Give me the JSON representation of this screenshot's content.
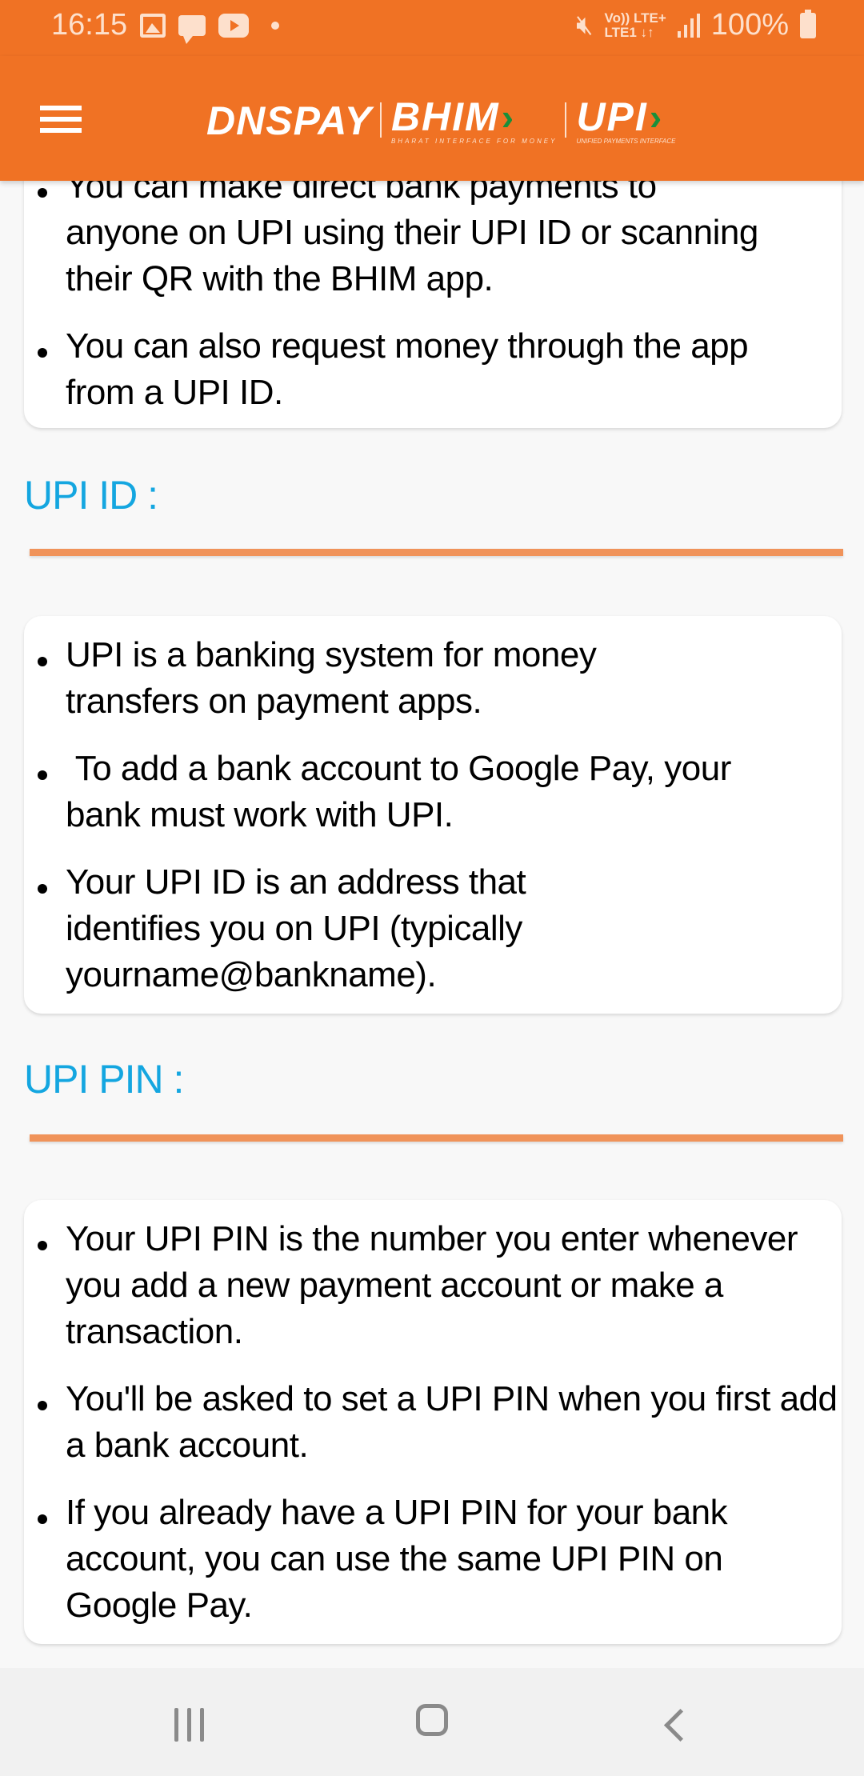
{
  "status_bar": {
    "time": "16:15",
    "left_icons": [
      "gallery-icon",
      "message-icon",
      "youtube-icon",
      "notification-dot-icon"
    ],
    "right_icons": [
      "mute-icon",
      "volte-lte-icon",
      "signal-icon",
      "battery-icon"
    ],
    "volte_top": "Vo)) LTE+",
    "volte_bottom": "LTE1 ↓↑",
    "battery": "100%"
  },
  "app_bar": {
    "menu_icon": "hamburger-menu-icon",
    "logo_dnspay": "DNSPAY",
    "logo_bhim": "BHIM",
    "logo_bhim_tagline": "BHARAT INTERFACE FOR MONEY",
    "logo_upi": "UPI",
    "logo_upi_tagline": "UNIFIED PAYMENTS INTERFACE",
    "logo_chevron": "›"
  },
  "colors": {
    "brand_orange": "#f07224",
    "section_title_blue": "#14a6e0",
    "divider_orange": "#f0935a",
    "chevron_green": "#1a8f3a"
  },
  "sections": [
    {
      "title": "",
      "bullets": [
        "You can make direct bank payments to anyone on UPI using their UPI ID or scanning their QR with the BHIM app.",
        "You can also request money through the app from a UPI ID."
      ]
    },
    {
      "title": "UPI ID :",
      "bullets": [
        "UPI is a banking system for money transfers on payment apps.",
        " To add a bank account to Google Pay, your bank must work with UPI.",
        "Your UPI ID is an address that identifies you on UPI (typically yourname@bankname)."
      ]
    },
    {
      "title": "UPI PIN :",
      "bullets": [
        "Your UPI PIN is the number you enter whenever you add a new payment account or make a transaction.",
        "You'll be asked to set a UPI PIN when you first add a bank account.",
        "If you already have a UPI PIN for your bank account, you can use the same UPI PIN on Google Pay."
      ]
    }
  ],
  "nav_bar": {
    "buttons": [
      "recents-icon",
      "home-icon",
      "back-icon"
    ]
  }
}
